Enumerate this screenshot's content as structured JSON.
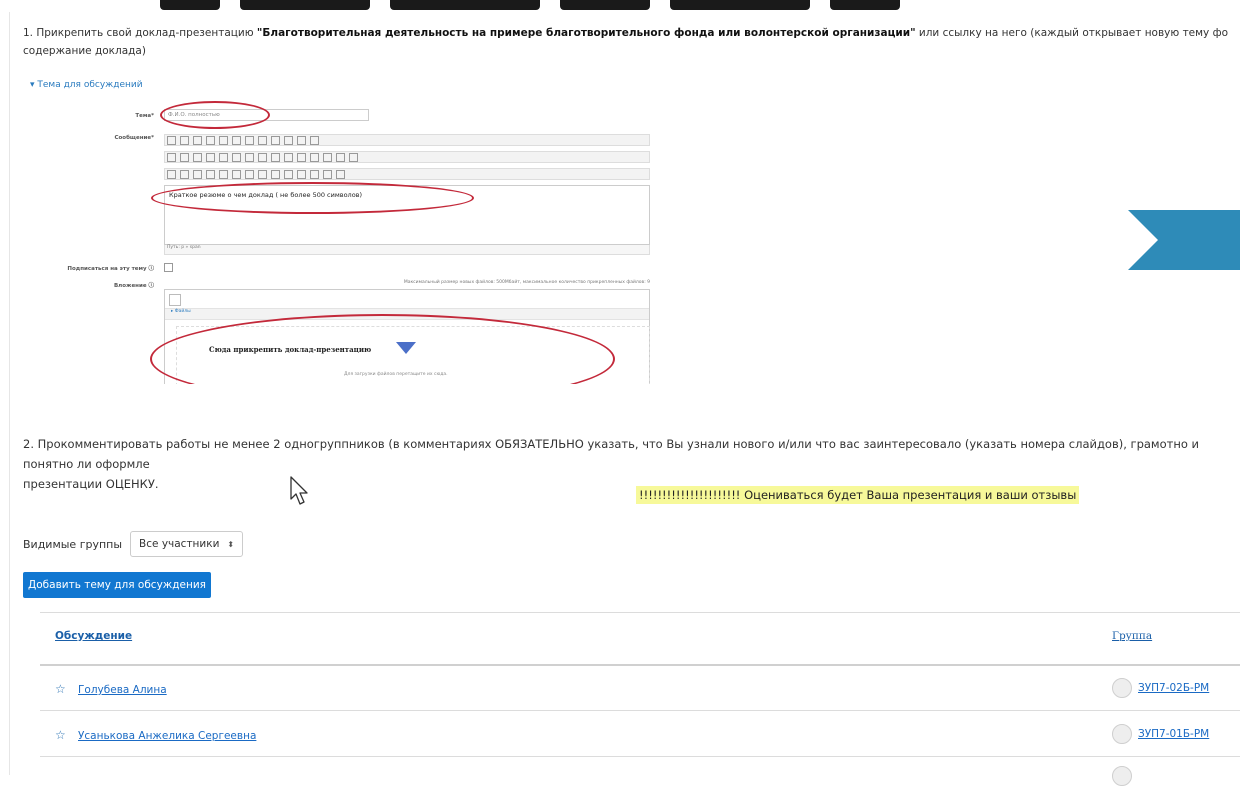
{
  "instructions": {
    "p1_prefix": "1. Прикрепить свой доклад-презентацию ",
    "p1_bold": "\"Благотворительная деятельность на примере благотворительного фонда или волонтерской организации\"",
    "p1_suffix": " или ссылку на него (каждый открывает новую тему фо",
    "p1_line2": "содержание доклада)",
    "p2_line1": "2. Прокомментировать работы не менее 2 одногруппников (в комментариях ОБЯЗАТЕЛЬНО указать, что Вы узнали нового и/или что вас заинтересовало (указать номера слайдов), грамотно и понятно ли оформле",
    "p2_line2": "презентации ОЦЕНКУ."
  },
  "screenshot": {
    "section_link": "▾ Тема для обсуждений",
    "subject_label": "Тема*",
    "subject_value": "Ф.И.О. полностью",
    "message_label": "Сообщение*",
    "message_text": "Краткое резюме о чем доклад ( не более 500 символов)",
    "path_text": "Путь: p » span",
    "subscribe_label": "Подписаться на эту тему",
    "attachment_label": "Вложение",
    "attachment_note": "Максимальный размер новых файлов: 500Мбайт, максимальное количество прикрепленных файлов: 9",
    "folder_link": "▸ Файлы",
    "drop_text": "Сюда прикрепить доклад-презентацию",
    "drop_sub": "Для загрузки файлов перетащите их сюда."
  },
  "notice": "!!!!!!!!!!!!!!!!!!!!!!  Оцениваться будет Ваша презентация и ваши отзывы",
  "filter": {
    "label": "Видимые группы",
    "selected": "Все участники",
    "arrow": "⬍"
  },
  "add_button": "Добавить тему для обсуждения",
  "table": {
    "col_discussion": "Обсуждение",
    "col_group": "Группа",
    "rows": [
      {
        "name": "Голубева Алина",
        "group": "ЗУП7-02Б-РМ"
      },
      {
        "name": "Усанькова Анжелика Сергеевна",
        "group": "ЗУП7-01Б-РМ"
      }
    ]
  },
  "colors": {
    "accent": "#1177d1",
    "link": "#1a6ac4",
    "highlight": "#f7f99a",
    "ellipse": "#c3293a",
    "chevron": "#2e8bb8"
  }
}
